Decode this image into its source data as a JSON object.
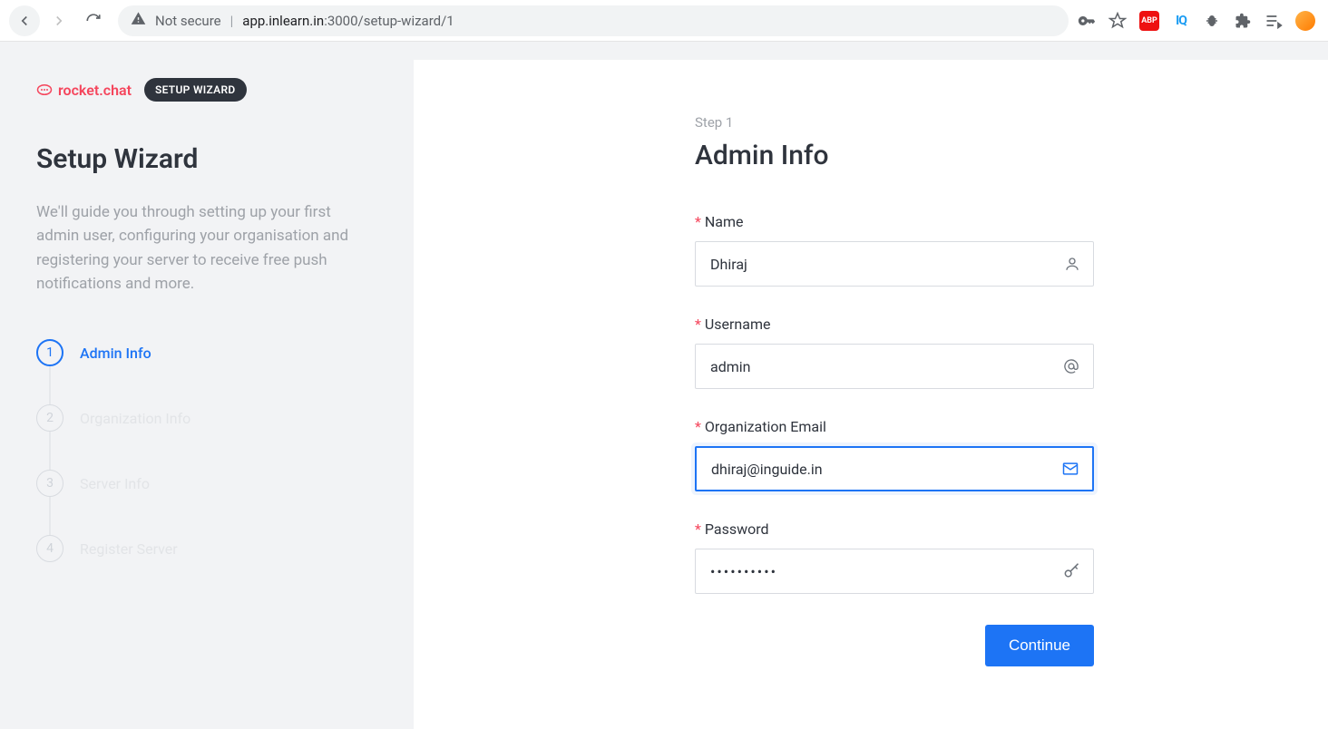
{
  "browser": {
    "not_secure_label": "Not secure",
    "url_host": "app.inlearn.in",
    "url_port": ":3000",
    "url_path": "/setup-wizard/1",
    "abp": "ABP",
    "iq": "IQ"
  },
  "sidebar": {
    "logo_text": "rocket.chat",
    "badge": "SETUP WIZARD",
    "title": "Setup Wizard",
    "description": "We'll guide you through setting up your first admin user, configuring your organisation and registering your server to receive free push notifications and more.",
    "steps": [
      {
        "num": "1",
        "label": "Admin Info"
      },
      {
        "num": "2",
        "label": "Organization Info"
      },
      {
        "num": "3",
        "label": "Server Info"
      },
      {
        "num": "4",
        "label": "Register Server"
      }
    ]
  },
  "form": {
    "step_indicator": "Step 1",
    "title": "Admin Info",
    "name_label": "Name",
    "name_value": "Dhiraj",
    "username_label": "Username",
    "username_value": "admin",
    "email_label": "Organization Email",
    "email_value": "dhiraj@inguide.in",
    "password_label": "Password",
    "password_value": "••••••••••",
    "continue": "Continue"
  }
}
